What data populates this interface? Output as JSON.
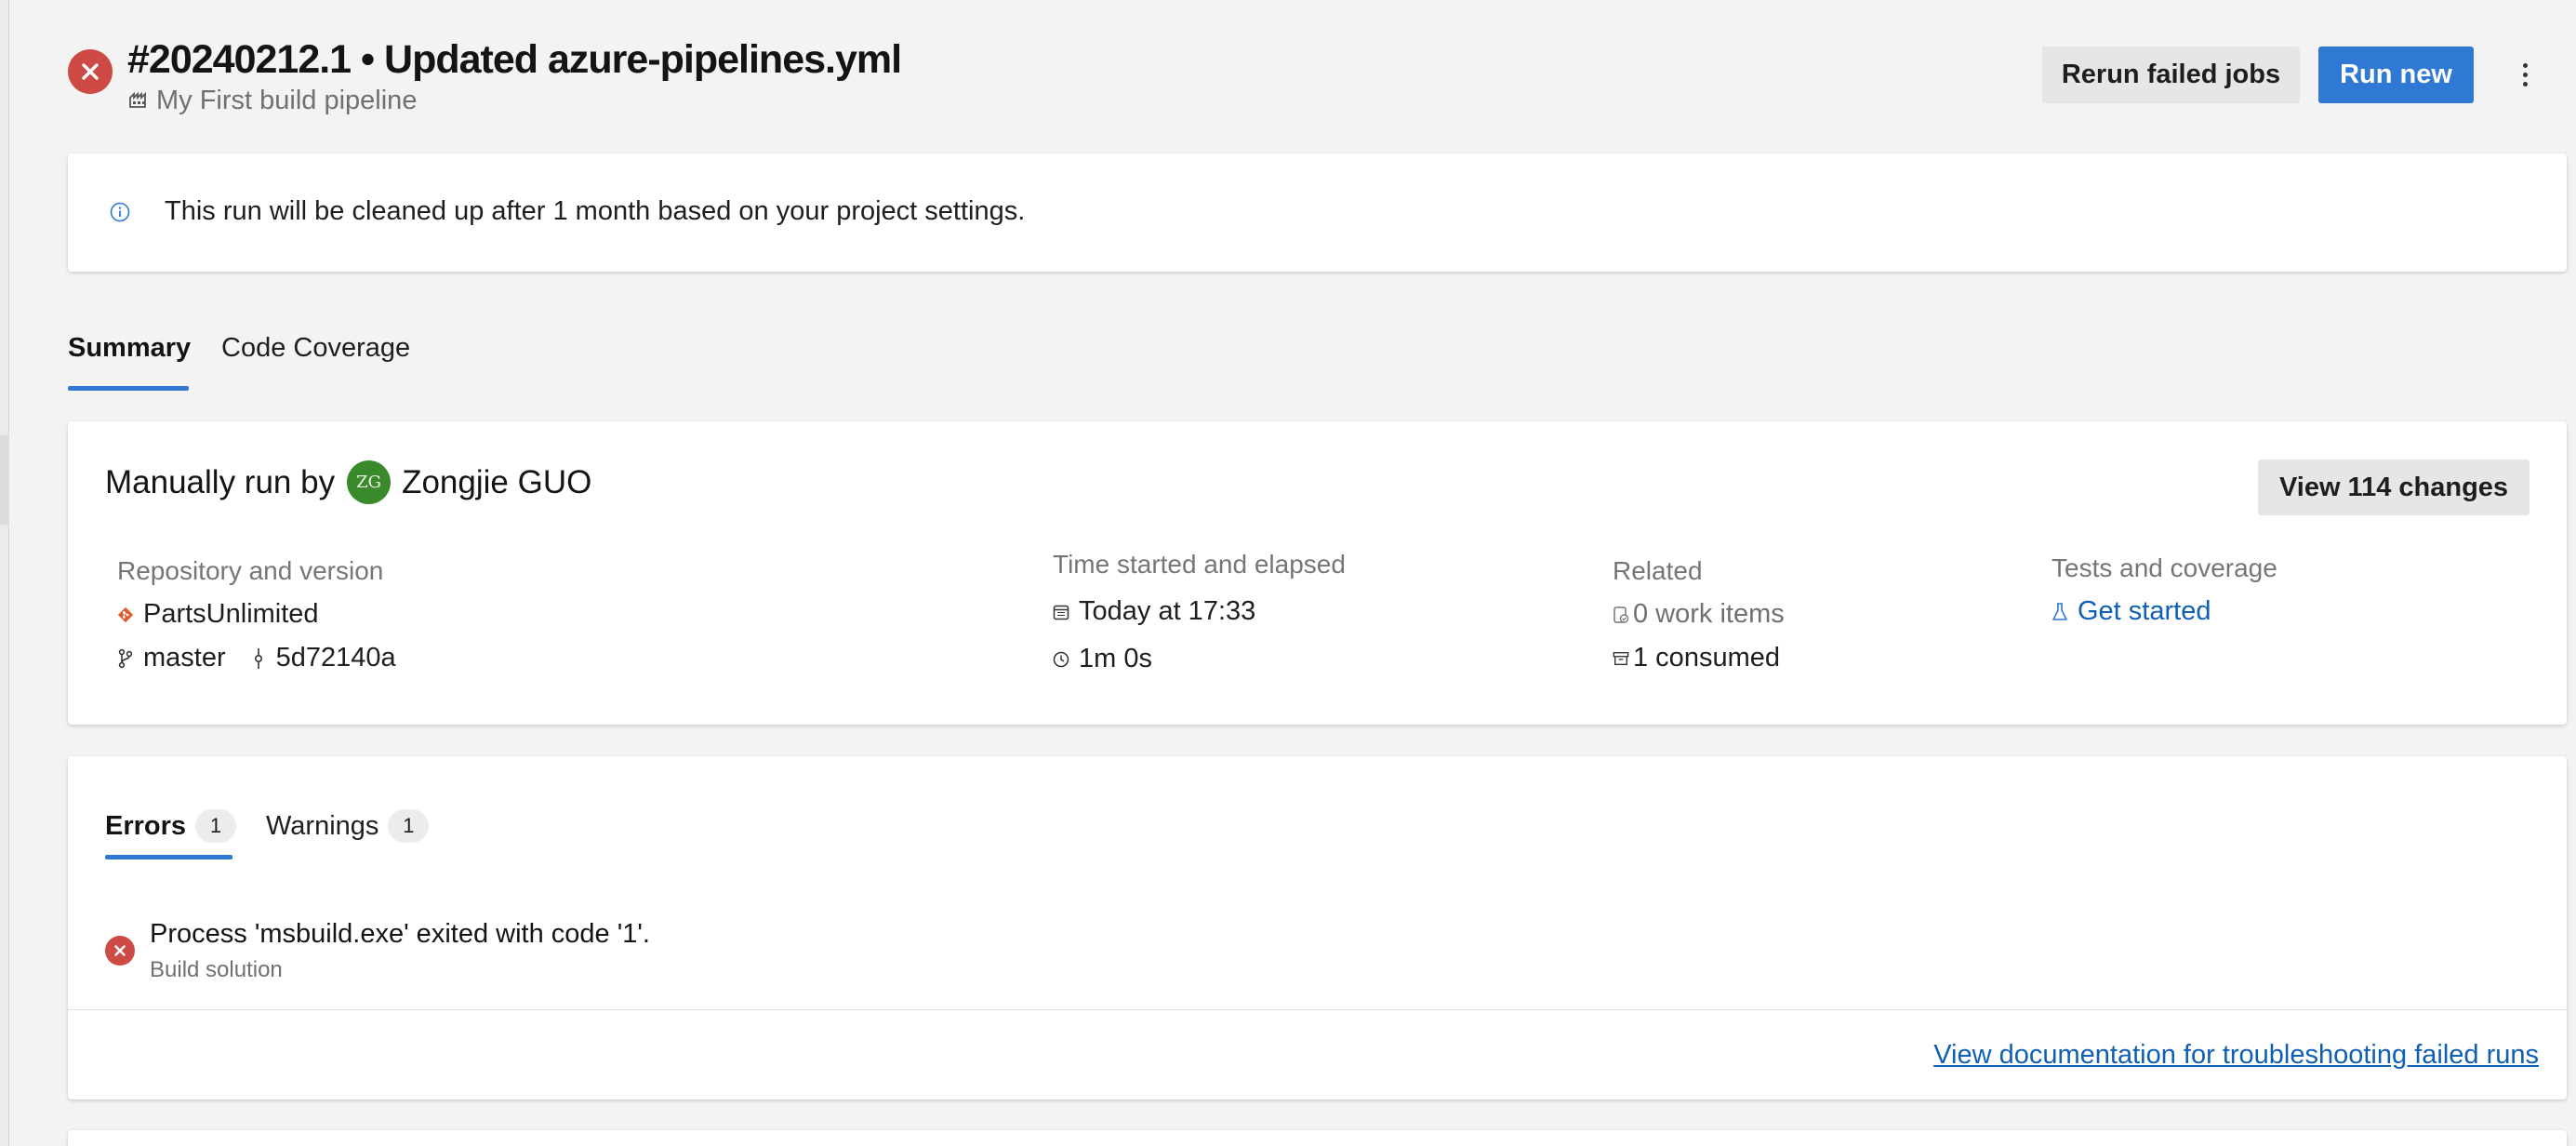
{
  "header": {
    "title": "#20240212.1 • Updated azure-pipelines.yml",
    "pipeline": "My First build pipeline",
    "status": "failed",
    "buttons": {
      "rerun": "Rerun failed jobs",
      "run_new": "Run new"
    }
  },
  "banner": {
    "message": "This run will be cleaned up after 1 month based on your project settings."
  },
  "tabs": [
    {
      "label": "Summary",
      "active": true
    },
    {
      "label": "Code Coverage",
      "active": false
    }
  ],
  "summary": {
    "manually_run_by": "Manually run by",
    "user_initials": "ZG",
    "user_name": "Zongjie GUO",
    "view_changes": "View 114 changes",
    "repo": {
      "label": "Repository and version",
      "name": "PartsUnlimited",
      "branch": "master",
      "commit": "5d72140a"
    },
    "time": {
      "label": "Time started and elapsed",
      "started": "Today at 17:33",
      "elapsed": "1m 0s"
    },
    "related": {
      "label": "Related",
      "work_items": "0 work items",
      "consumed": "1 consumed"
    },
    "tests": {
      "label": "Tests and coverage",
      "link": "Get started"
    }
  },
  "issues": {
    "tabs": [
      {
        "label": "Errors",
        "count": "1"
      },
      {
        "label": "Warnings",
        "count": "1"
      }
    ],
    "error": {
      "message": "Process 'msbuild.exe' exited with code '1'.",
      "source": "Build solution"
    },
    "doc_link": "View documentation for troubleshooting failed runs"
  },
  "colors": {
    "accent": "#2f78d4",
    "error": "#cd4a45",
    "link": "#0f5fb5",
    "avatar": "#3a8a2c",
    "git": "#e05a2b"
  }
}
